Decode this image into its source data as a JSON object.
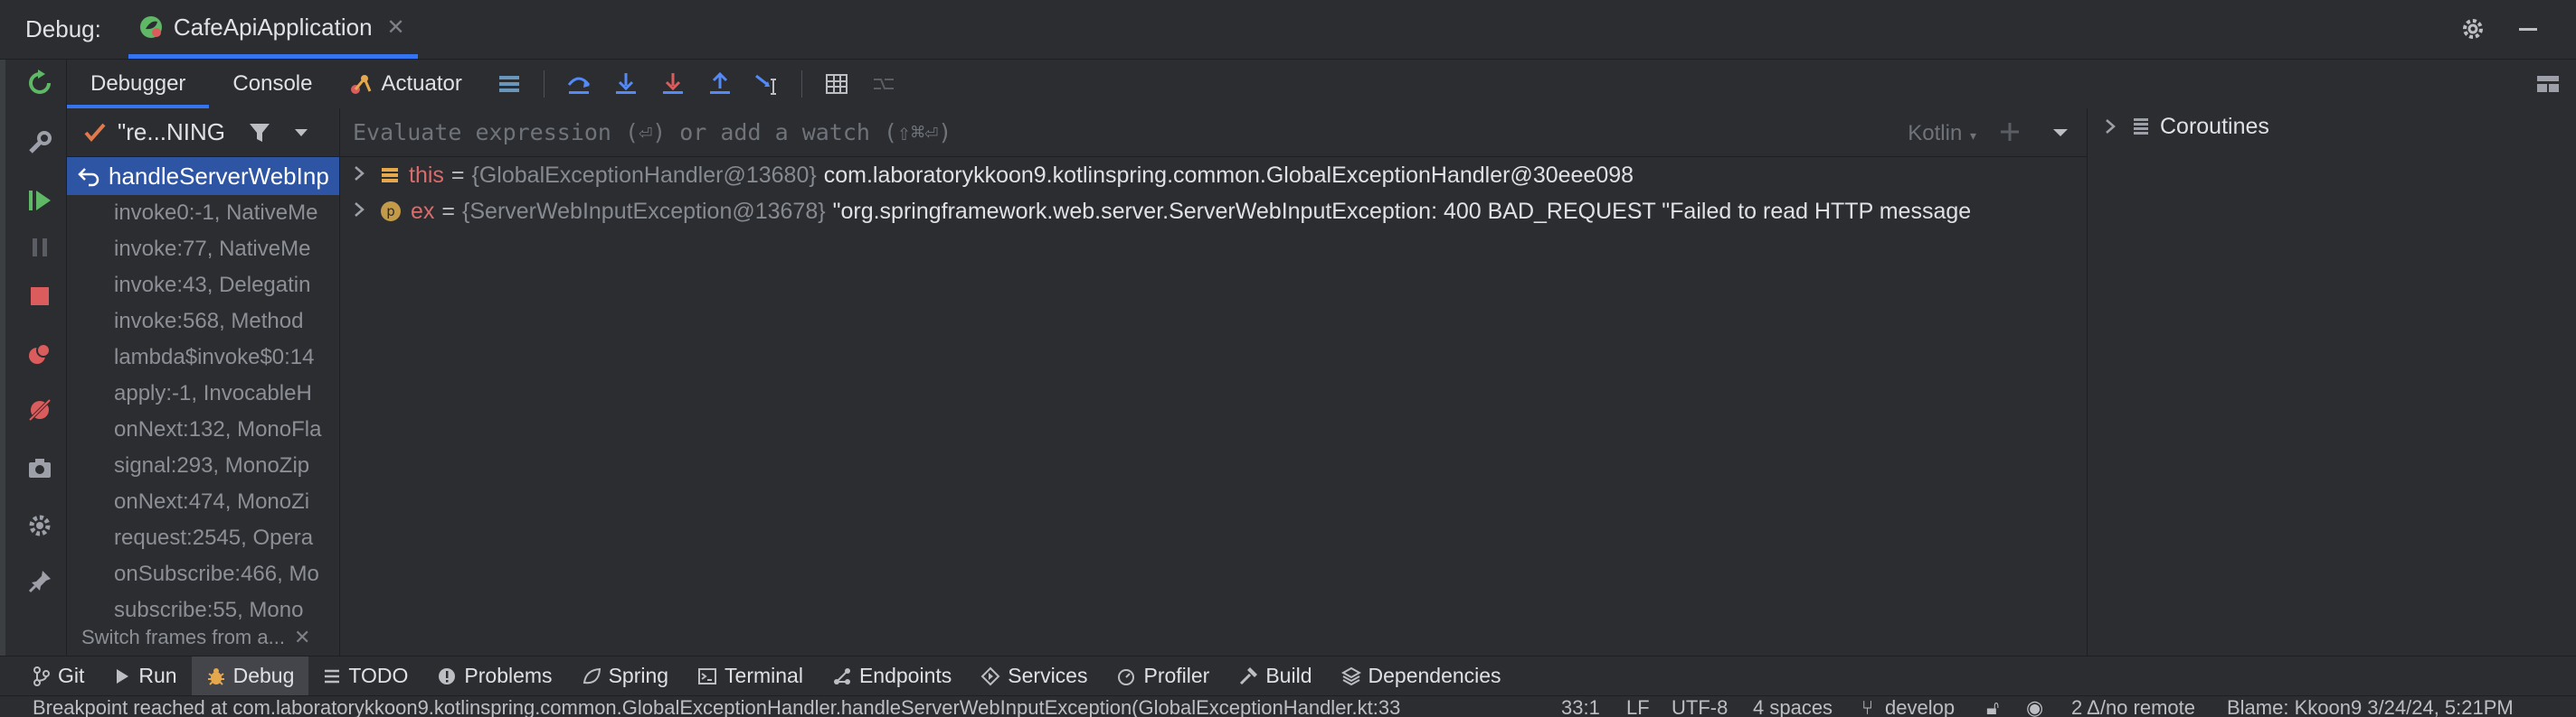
{
  "titlebar": {
    "debug_label": "Debug:",
    "run_config": "CafeApiApplication"
  },
  "toolbar": {
    "tabs": [
      "Debugger",
      "Console",
      "Actuator"
    ]
  },
  "frames": {
    "thread_label": "\"re...NING",
    "selected": "handleServerWebInp",
    "items": [
      "invoke0:-1, NativeMe",
      "invoke:77, NativeMe",
      "invoke:43, Delegatin",
      "invoke:568, Method",
      "lambda$invoke$0:14",
      "apply:-1, InvocableH",
      "onNext:132, MonoFla",
      "signal:293, MonoZip",
      "onNext:474, MonoZi",
      "request:2545, Opera",
      "onSubscribe:466, Mo",
      "subscribe:55, Mono"
    ],
    "hint": "Switch frames from a..."
  },
  "evaluate": {
    "placeholder": "Evaluate expression (⏎) or add a watch (⇧⌘⏎)",
    "language": "Kotlin"
  },
  "variables": [
    {
      "name": "this",
      "ref": "{GlobalExceptionHandler@13680}",
      "value": "com.laboratorykkoon9.kotlinspring.common.GlobalExceptionHandler@30eee098",
      "icon": "field-icon"
    },
    {
      "name": "ex",
      "ref": "{ServerWebInputException@13678}",
      "value": "\"org.springframework.web.server.ServerWebInputException: 400 BAD_REQUEST \"Failed to read HTTP message",
      "icon": "parameter-icon"
    }
  ],
  "coroutines": {
    "label": "Coroutines"
  },
  "tool_windows": [
    {
      "label": "Git",
      "icon": "git-icon"
    },
    {
      "label": "Run",
      "icon": "run-icon"
    },
    {
      "label": "Debug",
      "icon": "debug-icon",
      "active": true
    },
    {
      "label": "TODO",
      "icon": "todo-icon"
    },
    {
      "label": "Problems",
      "icon": "problems-icon"
    },
    {
      "label": "Spring",
      "icon": "spring-icon"
    },
    {
      "label": "Terminal",
      "icon": "terminal-icon"
    },
    {
      "label": "Endpoints",
      "icon": "endpoints-icon"
    },
    {
      "label": "Services",
      "icon": "services-icon"
    },
    {
      "label": "Profiler",
      "icon": "profiler-icon"
    },
    {
      "label": "Build",
      "icon": "build-icon"
    },
    {
      "label": "Dependencies",
      "icon": "dependencies-icon"
    }
  ],
  "statusbar": {
    "message": "Breakpoint reached at com.laboratorykkoon9.kotlinspring.common.GlobalExceptionHandler.handleServerWebInputException(GlobalExceptionHandler.kt:33",
    "position": "33:1",
    "line_ending": "LF",
    "encoding": "UTF-8",
    "indent": "4 spaces",
    "branch": "develop",
    "vcs_remote": "2 Δ/no remote",
    "blame": "Blame: Kkoon9 3/24/24, 5:21PM"
  },
  "colors": {
    "accent": "#3574f0",
    "selection": "#2e55a3",
    "run_green": "#5fb865",
    "stop_red": "#db5c5c"
  }
}
